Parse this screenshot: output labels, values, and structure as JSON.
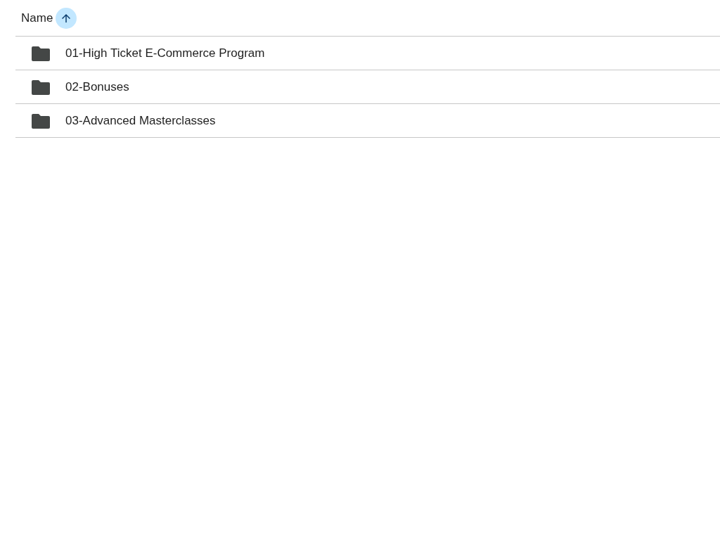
{
  "header": {
    "column_label": "Name",
    "sort_ascending": true
  },
  "rows": [
    {
      "name": "01-High Ticket E-Commerce Program"
    },
    {
      "name": "02-Bonuses"
    },
    {
      "name": "03-Advanced Masterclasses"
    }
  ]
}
